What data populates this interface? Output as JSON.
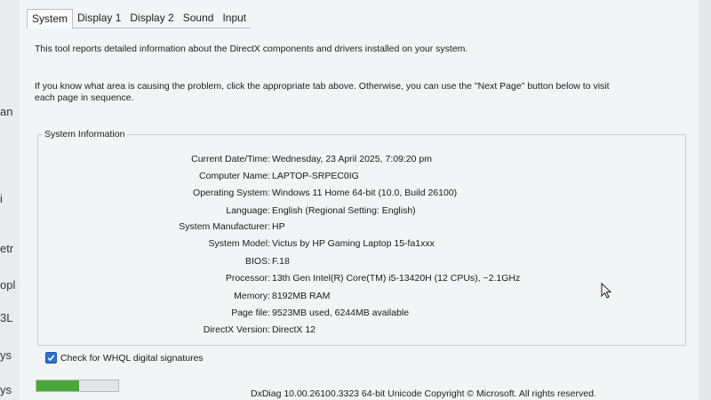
{
  "background_fragments": [
    "an",
    "i",
    "etr",
    "opl",
    "3L",
    "ys",
    "ys"
  ],
  "tabs": [
    {
      "label": "System",
      "active": true
    },
    {
      "label": "Display 1",
      "active": false
    },
    {
      "label": "Display 2",
      "active": false
    },
    {
      "label": "Sound",
      "active": false
    },
    {
      "label": "Input",
      "active": false
    }
  ],
  "intro": {
    "line1": "This tool reports detailed information about the DirectX components and drivers installed on your system.",
    "line2": "If you know what area is causing the problem, click the appropriate tab above.  Otherwise, you can use the \"Next Page\" button below to visit each page in sequence."
  },
  "system_info": {
    "title": "System Information",
    "rows": [
      {
        "label": "Current Date/Time:",
        "value": "Wednesday, 23 April 2025, 7:09:20 pm"
      },
      {
        "label": "Computer Name:",
        "value": "LAPTOP-SRPEC0IG"
      },
      {
        "label": "Operating System:",
        "value": "Windows 11 Home 64-bit (10.0, Build 26100)"
      },
      {
        "label": "Language:",
        "value": "English (Regional Setting: English)"
      },
      {
        "label": "System Manufacturer:",
        "value": "HP"
      },
      {
        "label": "System Model:",
        "value": "Victus by HP Gaming Laptop 15-fa1xxx"
      },
      {
        "label": "BIOS:",
        "value": "F.18"
      },
      {
        "label": "Processor:",
        "value": "13th Gen Intel(R) Core(TM) i5-13420H (12 CPUs), ~2.1GHz"
      },
      {
        "label": "Memory:",
        "value": "8192MB RAM"
      },
      {
        "label": "Page file:",
        "value": "9523MB used, 6244MB available"
      },
      {
        "label": "DirectX Version:",
        "value": "DirectX 12"
      }
    ]
  },
  "whql_checkbox": {
    "label": "Check for WHQL digital signatures",
    "checked": true
  },
  "progress": {
    "fraction": 0.52,
    "color": "#4aa83a"
  },
  "footer": "DxDiag 10.00.26100.3323 64-bit Unicode  Copyright © Microsoft. All rights reserved."
}
